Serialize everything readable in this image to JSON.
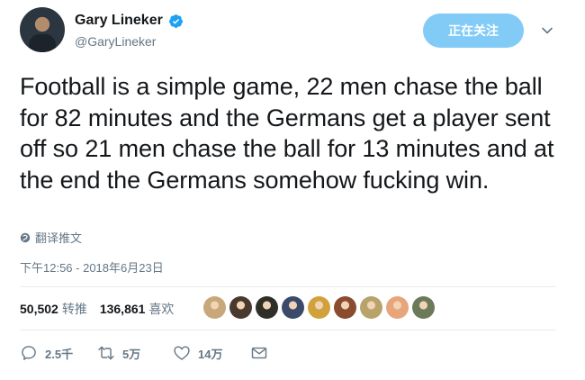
{
  "author": {
    "display_name": "Gary Lineker",
    "handle": "@GaryLineker",
    "verified": true
  },
  "follow_button_label": "正在关注",
  "tweet": {
    "text": "Football is a simple game, 22 men chase the ball for 82 minutes and the Germans get a player sent off so 21 men chase the ball for 13 minutes and at the end the Germans somehow fucking win.",
    "translate_label": "翻译推文",
    "timestamp": "下午12:56 - 2018年6月23日"
  },
  "stats": {
    "retweets_count": "50,502",
    "retweets_label": "转推",
    "likes_count": "136,861",
    "likes_label": "喜欢"
  },
  "likers": [
    {
      "color": "#c8a77a"
    },
    {
      "color": "#4a3a2e"
    },
    {
      "color": "#2f2f28"
    },
    {
      "color": "#3b4a6b"
    },
    {
      "color": "#d1a23c"
    },
    {
      "color": "#8a4b2f"
    },
    {
      "color": "#b8a46a"
    },
    {
      "color": "#e7a57a"
    },
    {
      "color": "#6c7a5a"
    }
  ],
  "actions": {
    "reply_count": "2.5千",
    "retweet_count": "5万",
    "like_count": "14万"
  },
  "colors": {
    "accent": "#1da1f2",
    "muted": "#657786",
    "text": "#14171a"
  }
}
